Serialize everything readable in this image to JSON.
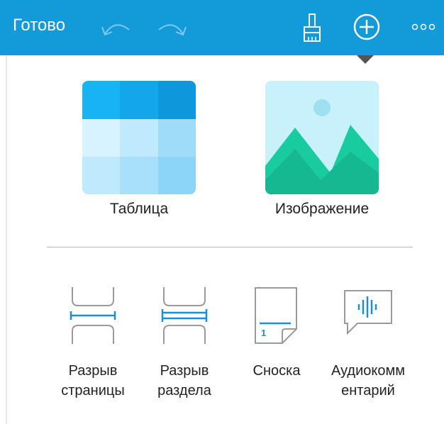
{
  "toolbar": {
    "done_label": "Готово",
    "background": "#139ad9",
    "icons": [
      "undo-icon",
      "redo-icon",
      "brush-icon",
      "add-circle-icon",
      "more-icon"
    ]
  },
  "insert": {
    "primary": [
      {
        "label": "Таблица",
        "icon": "table-icon"
      },
      {
        "label": "Изображение",
        "icon": "image-icon"
      }
    ],
    "secondary": [
      {
        "line1": "Разрыв",
        "line2": "страницы",
        "icon": "page-break-icon"
      },
      {
        "line1": "Разрыв",
        "line2": "раздела",
        "icon": "section-break-icon"
      },
      {
        "line1": "Сноска",
        "line2": "",
        "icon": "footnote-icon"
      },
      {
        "line1": "Аудиокомм",
        "line2": "ентарий",
        "icon": "audio-comment-icon"
      }
    ]
  },
  "colors": {
    "accent": "#139ad9",
    "icon_blue": "#1a8fd6",
    "image_green": "#19cca0"
  }
}
